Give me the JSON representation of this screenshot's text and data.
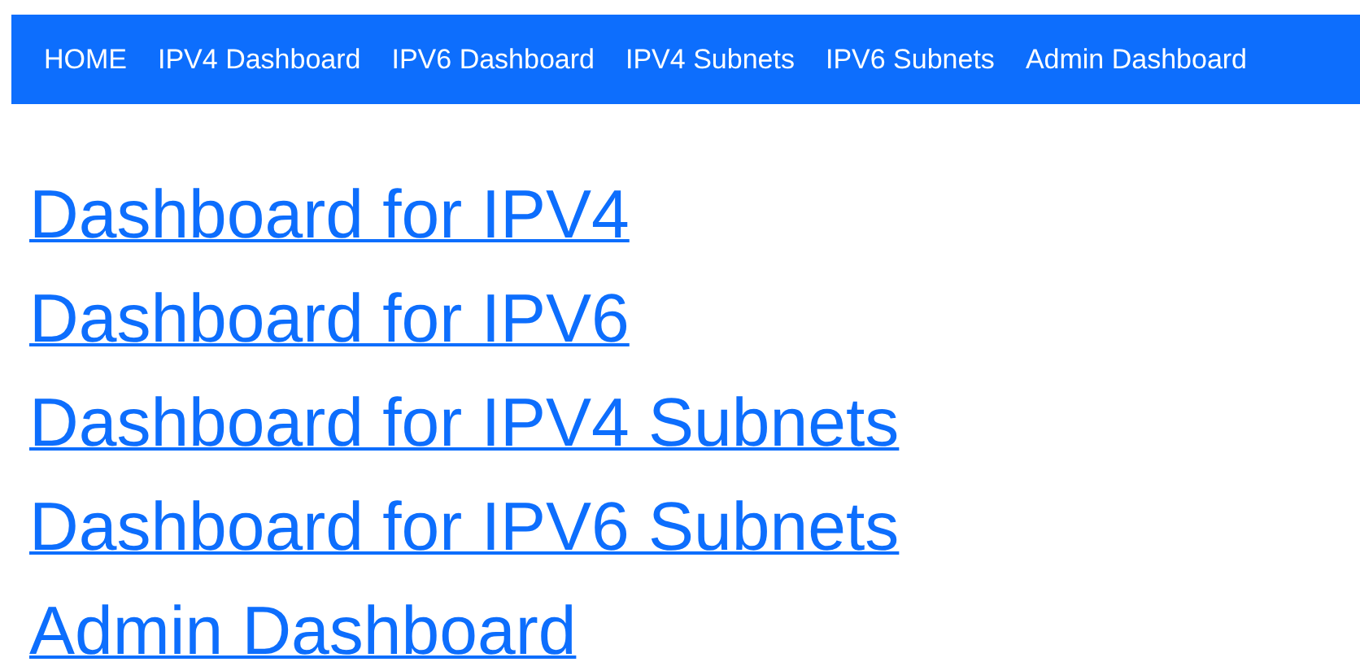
{
  "nav": {
    "items": [
      {
        "label": "HOME"
      },
      {
        "label": "IPV4 Dashboard"
      },
      {
        "label": "IPV6 Dashboard"
      },
      {
        "label": "IPV4 Subnets"
      },
      {
        "label": "IPV6 Subnets"
      },
      {
        "label": "Admin Dashboard"
      }
    ]
  },
  "links": [
    {
      "label": "Dashboard for IPV4"
    },
    {
      "label": "Dashboard for IPV6"
    },
    {
      "label": "Dashboard for IPV4 Subnets"
    },
    {
      "label": "Dashboard for IPV6 Subnets"
    },
    {
      "label": "Admin Dashboard"
    }
  ]
}
